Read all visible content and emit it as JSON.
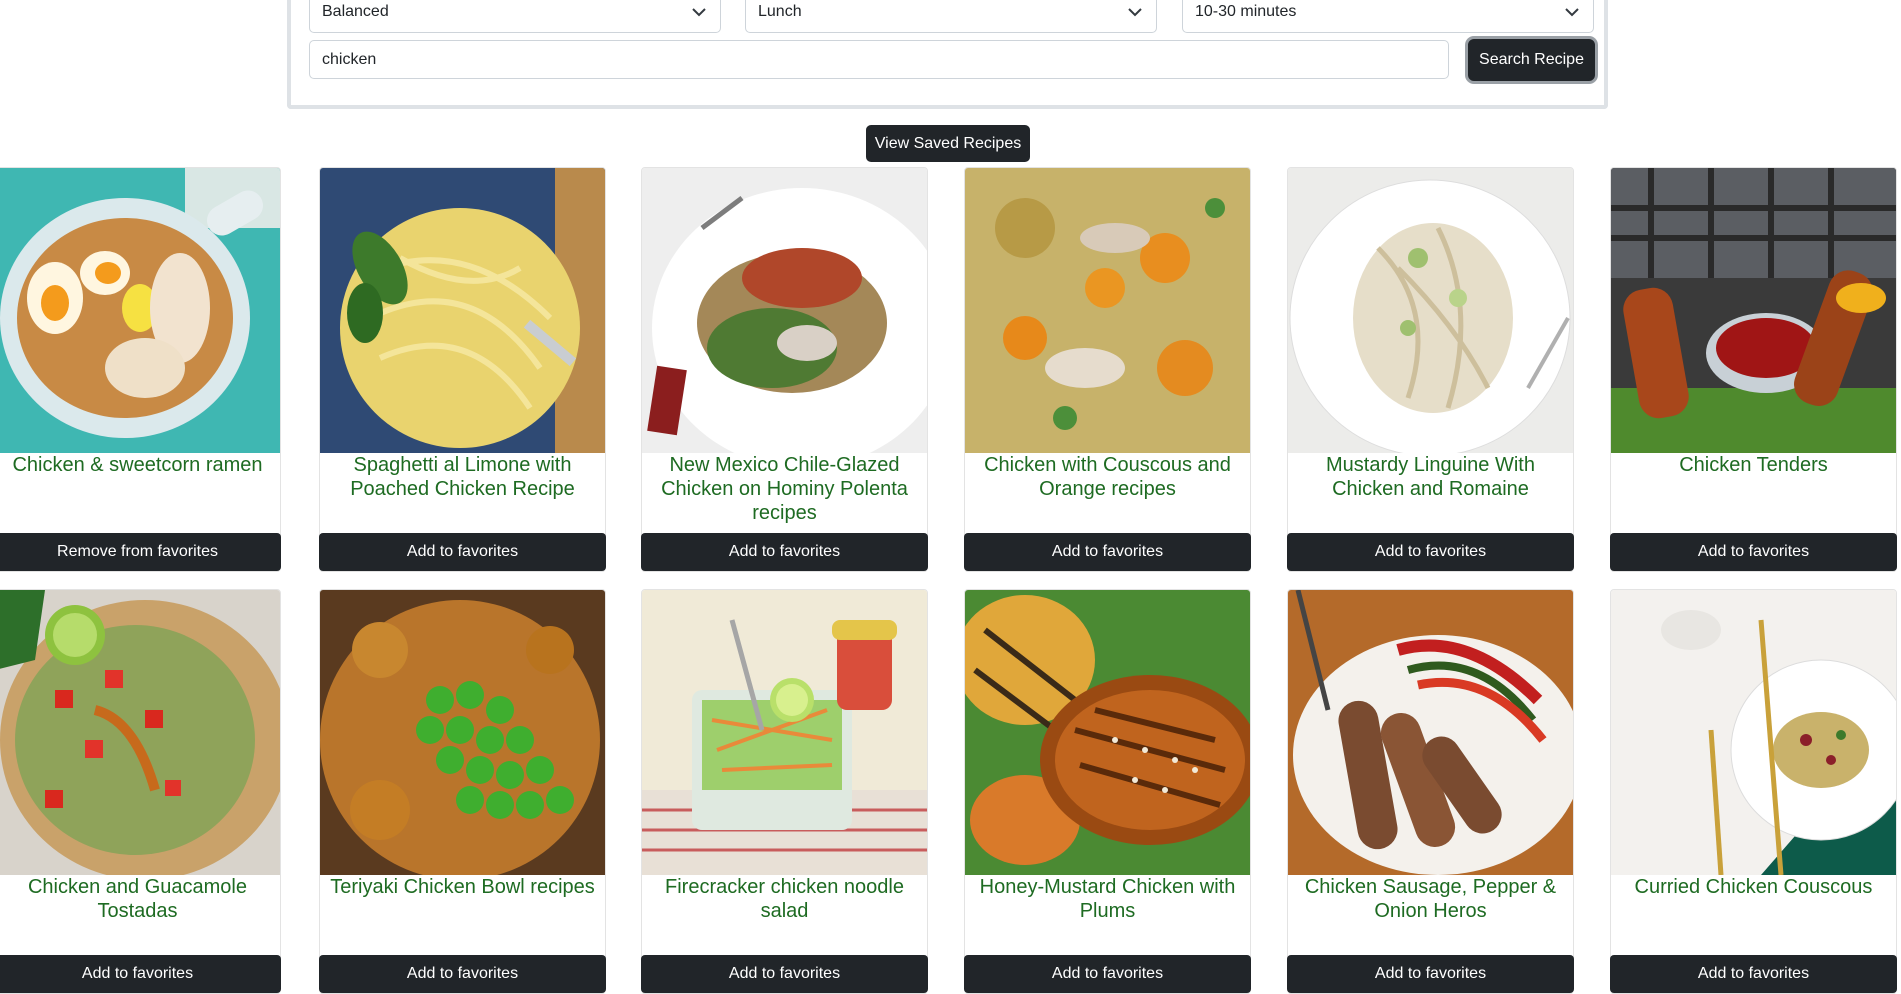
{
  "filters": {
    "diet": "Balanced",
    "meal_type": "Lunch",
    "time": "10-30 minutes"
  },
  "search": {
    "value": "chicken",
    "button_label": "Search Recipe"
  },
  "saved_button_label": "View Saved Recipes",
  "recipes": [
    {
      "title": "Chicken & sweetcorn ramen",
      "button": "Remove from favorites",
      "image": "ramen"
    },
    {
      "title": "Spaghetti al Limone with Poached Chicken Recipe",
      "button": "Add to favorites",
      "image": "spaghetti"
    },
    {
      "title": "New Mexico Chile-Glazed Chicken on Hominy Polenta recipes",
      "button": "Add to favorites",
      "image": "glazed-chicken"
    },
    {
      "title": "Chicken with Couscous and Orange recipes",
      "button": "Add to favorites",
      "image": "couscous"
    },
    {
      "title": "Mustardy Linguine With Chicken and Romaine",
      "button": "Add to favorites",
      "image": "linguine"
    },
    {
      "title": "Chicken Tenders",
      "button": "Add to favorites",
      "image": "tenders"
    },
    {
      "title": "Chicken and Guacamole Tostadas",
      "button": "Add to favorites",
      "image": "tostadas"
    },
    {
      "title": "Teriyaki Chicken Bowl recipes",
      "button": "Add to favorites",
      "image": "teriyaki"
    },
    {
      "title": "Firecracker chicken noodle salad",
      "button": "Add to favorites",
      "image": "noodle-salad"
    },
    {
      "title": "Honey-Mustard Chicken with Plums",
      "button": "Add to favorites",
      "image": "honey-mustard"
    },
    {
      "title": "Chicken Sausage, Pepper & Onion Heros",
      "button": "Add to favorites",
      "image": "sausage"
    },
    {
      "title": "Curried Chicken Couscous",
      "button": "Add to favorites",
      "image": "curried-couscous"
    }
  ]
}
